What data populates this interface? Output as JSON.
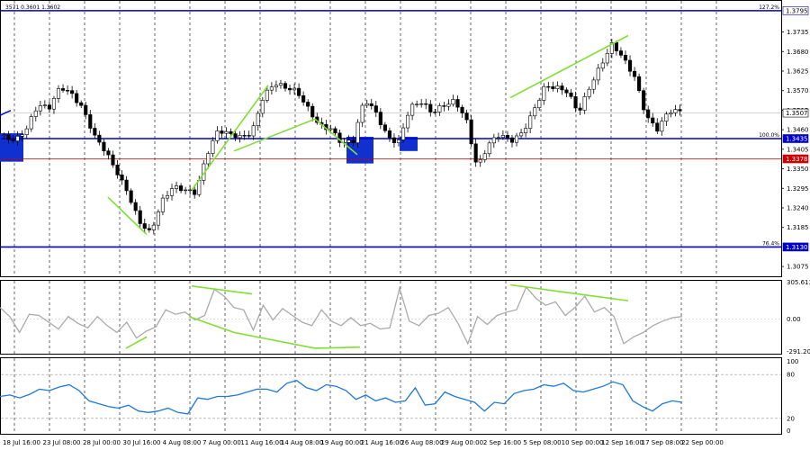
{
  "header": {
    "ohlc_text": "3571 0.3601 1.3602"
  },
  "chart_data": [
    {
      "type": "candlestick",
      "name": "price",
      "x_ticks": [
        "18 Jul 16:00",
        "23 Jul 08:00",
        "28 Jul 00:00",
        "30 Jul 16:00",
        "4 Aug 08:00",
        "7 Aug 00:00",
        "11 Aug 16:00",
        "14 Aug 08:00",
        "19 Aug 00:00",
        "21 Aug 16:00",
        "26 Aug 08:00",
        "29 Aug 00:00",
        "2 Sep 16:00",
        "5 Sep 08:00",
        "10 Sep 00:00",
        "12 Sep 16:00",
        "17 Sep 08:00",
        "22 Sep 00:00"
      ],
      "y_ticks": [
        "1.3735",
        "1.3680",
        "1.3625",
        "1.3570",
        "1.3515",
        "1.3460",
        "1.3405",
        "1.3350",
        "1.3295",
        "1.3240",
        "1.3185",
        "1.3075"
      ],
      "ylim": [
        1.305,
        1.382
      ],
      "grid": true,
      "last_price": "1.3507",
      "levels": [
        {
          "label": "1.3795",
          "tag": "127.2%",
          "value": 1.3795,
          "color": "#0000cc"
        },
        {
          "label": "1.3435",
          "tag": "100.0%",
          "value": 1.3435,
          "color": "#0000cc"
        },
        {
          "label": "1.3378",
          "tag": "",
          "value": 1.3378,
          "color": "#cc0000"
        },
        {
          "label": "1.3130",
          "tag": "76.4%",
          "value": 1.313,
          "color": "#0000cc"
        }
      ],
      "close_path": [
        1.344,
        1.342,
        1.3455,
        1.353,
        1.353,
        1.359,
        1.356,
        1.351,
        1.3435,
        1.34,
        1.335,
        1.329,
        1.32,
        1.316,
        1.325,
        1.33,
        1.33,
        1.329,
        1.339,
        1.345,
        1.344,
        1.344,
        1.346,
        1.356,
        1.359,
        1.357,
        1.356,
        1.352,
        1.348,
        1.347,
        1.342,
        1.342,
        1.354,
        1.351,
        1.345,
        1.343,
        1.352,
        1.353,
        1.35,
        1.353,
        1.355,
        1.35,
        1.335,
        1.341,
        1.344,
        1.343,
        1.346,
        1.352,
        1.358,
        1.357,
        1.356,
        1.351,
        1.359,
        1.365,
        1.37,
        1.365,
        1.36,
        1.35,
        1.347,
        1.352,
        1.351
      ],
      "trend_lines": [
        {
          "points": [
            [
              120,
              1.327
            ],
            [
              163,
              1.3165
            ]
          ],
          "color": "#7fe030"
        },
        {
          "points": [
            [
              213,
              1.329
            ],
            [
              298,
              1.3585
            ]
          ],
          "color": "#7fe030"
        },
        {
          "points": [
            [
              260,
              1.34
            ],
            [
              350,
              1.349
            ],
            [
              397,
              1.339
            ]
          ],
          "color": "#7fe030"
        },
        {
          "points": [
            [
              567,
              1.355
            ],
            [
              698,
              1.3725
            ]
          ],
          "color": "#7fe030"
        }
      ],
      "boxes": [
        {
          "x": [
            0,
            26
          ],
          "y": [
            1.337,
            1.345
          ],
          "color": "#1030d0"
        },
        {
          "x": [
            385,
            415
          ],
          "y": [
            1.3365,
            1.344
          ],
          "color": "#1030d0"
        },
        {
          "x": [
            444,
            464
          ],
          "y": [
            1.34,
            1.344
          ],
          "color": "#1030d0"
        }
      ]
    },
    {
      "type": "line",
      "name": "cci",
      "y_ticks": [
        "305.613",
        "0.00",
        "-291.209"
      ],
      "ylim": [
        -300,
        320
      ],
      "color": "#aaaaaa",
      "values": [
        100,
        20,
        -120,
        40,
        30,
        -30,
        -90,
        20,
        -40,
        -80,
        20,
        -60,
        -120,
        -30,
        -170,
        -110,
        -70,
        80,
        40,
        60,
        -10,
        30,
        260,
        200,
        100,
        80,
        -100,
        120,
        -10,
        90,
        30,
        -30,
        -60,
        80,
        -20,
        -60,
        10,
        -60,
        -40,
        -90,
        -80,
        270,
        -20,
        -60,
        30,
        50,
        100,
        -40,
        -220,
        20,
        -50,
        30,
        60,
        80,
        280,
        180,
        120,
        150,
        30,
        100,
        200,
        60,
        100,
        20,
        -220,
        -160,
        -120,
        -60,
        -20,
        10,
        20
      ],
      "divergence_lines": [
        {
          "points": [
            [
              140,
              -260
            ],
            [
              163,
              -160
            ]
          ],
          "color": "#7fe030"
        },
        {
          "points": [
            [
              213,
              290
            ],
            [
              280,
              220
            ]
          ],
          "color": "#7fe030"
        },
        {
          "points": [
            [
              210,
              20
            ],
            [
              260,
              -120
            ],
            [
              350,
              -260
            ],
            [
              400,
              -250
            ]
          ],
          "color": "#7fe030"
        },
        {
          "points": [
            [
              567,
              300
            ],
            [
              698,
              160
            ]
          ],
          "color": "#7fe030"
        }
      ]
    },
    {
      "type": "line",
      "name": "rsi",
      "y_ticks": [
        "100",
        "80",
        "20",
        "0"
      ],
      "ylim": [
        0,
        100
      ],
      "levels": [
        80,
        20
      ],
      "color": "#1e78dc",
      "values": [
        50,
        52,
        48,
        53,
        60,
        58,
        63,
        66,
        58,
        44,
        40,
        36,
        34,
        38,
        30,
        28,
        30,
        34,
        28,
        26,
        48,
        46,
        50,
        50,
        52,
        56,
        60,
        60,
        56,
        68,
        72,
        62,
        58,
        66,
        64,
        58,
        46,
        52,
        44,
        48,
        42,
        44,
        62,
        38,
        40,
        56,
        50,
        46,
        42,
        30,
        42,
        40,
        54,
        58,
        60,
        66,
        64,
        68,
        58,
        56,
        60,
        64,
        70,
        66,
        44,
        36,
        30,
        40,
        44,
        42
      ]
    }
  ]
}
